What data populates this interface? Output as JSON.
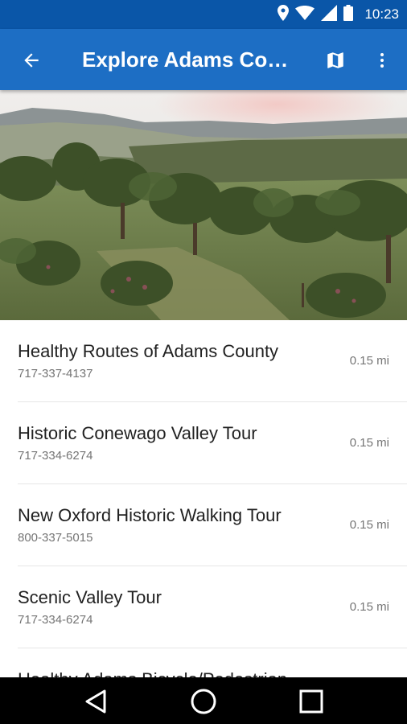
{
  "status_bar": {
    "time": "10:23",
    "icons": [
      "location-icon",
      "wifi-icon",
      "signal-icon",
      "battery-icon"
    ]
  },
  "app_bar": {
    "title": "Explore Adams County",
    "back_icon": "arrow-back-icon",
    "map_icon": "map-icon",
    "more_icon": "more-vert-icon"
  },
  "hero": {
    "image": "orchard-landscape"
  },
  "list": {
    "items": [
      {
        "name": "Healthy Routes of Adams County",
        "phone": "717-337-4137",
        "distance": "0.15 mi"
      },
      {
        "name": "Historic Conewago Valley Tour",
        "phone": "717-334-6274",
        "distance": "0.15 mi"
      },
      {
        "name": "New Oxford Historic Walking Tour",
        "phone": "800-337-5015",
        "distance": "0.15 mi"
      },
      {
        "name": "Scenic Valley Tour",
        "phone": "717-334-6274",
        "distance": "0.15 mi"
      },
      {
        "name": "Healthy Adams Bicycle/Pedestrian",
        "phone": "",
        "distance": ""
      }
    ]
  },
  "nav_bar": {
    "icons": [
      "back-triangle-icon",
      "home-circle-icon",
      "recents-square-icon"
    ]
  },
  "colors": {
    "status_bar": "#0a56a8",
    "app_bar": "#1d6ec4",
    "nav_bar": "#000000"
  }
}
